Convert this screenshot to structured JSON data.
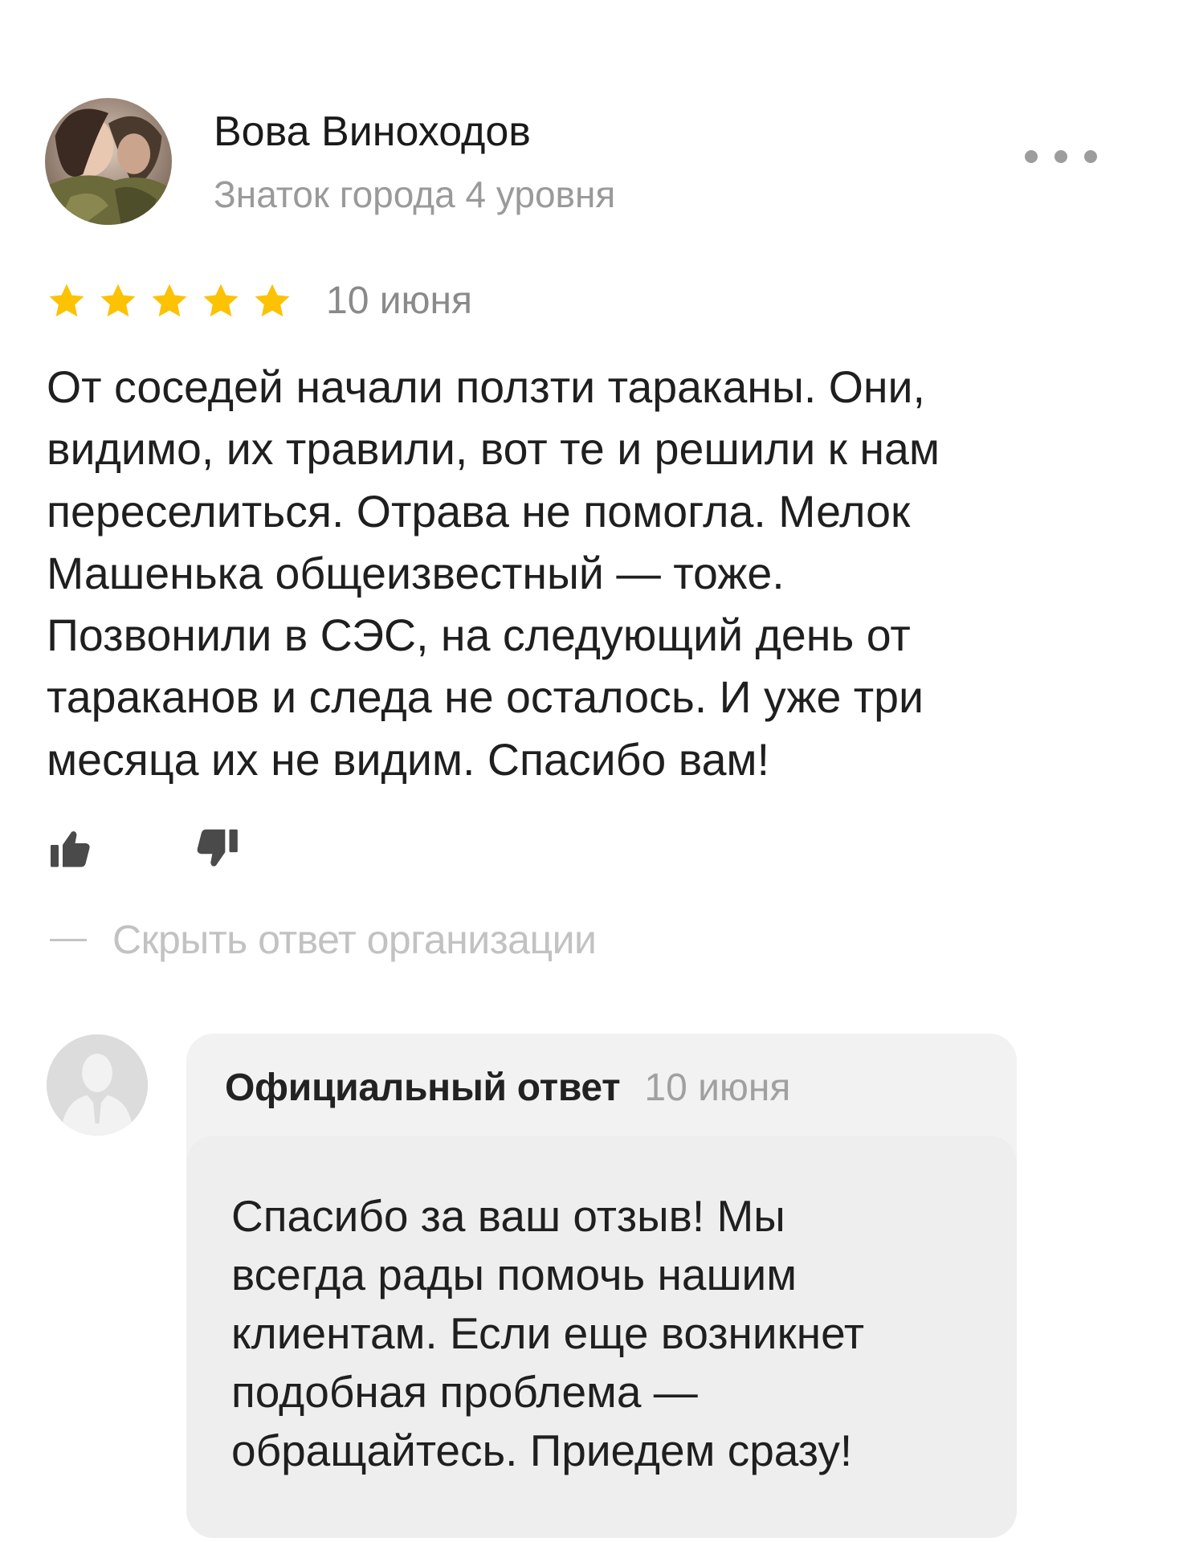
{
  "review": {
    "author": {
      "name": "Вова Виноходов",
      "level": "Знаток города 4 уровня",
      "avatar": "user-photo-avatar"
    },
    "more_icon": "more-dots-icon",
    "rating": {
      "stars": 5,
      "max": 5,
      "star_color": "#FCC203"
    },
    "date": "10 июня",
    "text_lines": [
      "От соседей начали ползти тараканы. Они,",
      "видимо, их травили, вот те и решили к нам",
      "переселиться. Отрава не помогла. Мелок",
      "Машенька общеизвестный — тоже.",
      "Позвонили в СЭС, на следующий день от",
      "тараканов и следа не осталось. И уже три",
      "месяца их не видим. Спасибо вам!"
    ],
    "like_icon": "thumbs-up-icon",
    "dislike_icon": "thumbs-down-icon"
  },
  "hide_answer": {
    "label": "Скрыть ответ организации"
  },
  "org_answer": {
    "avatar": "org-silhouette-avatar",
    "title": "Официальный ответ",
    "date": "10 июня",
    "text_lines": [
      "Спасибо за ваш отзыв! Мы",
      "всегда рады помочь нашим",
      "клиентам. Если еще возникнет",
      "подобная проблема —",
      "обращайтесь. Приедем сразу!"
    ]
  }
}
